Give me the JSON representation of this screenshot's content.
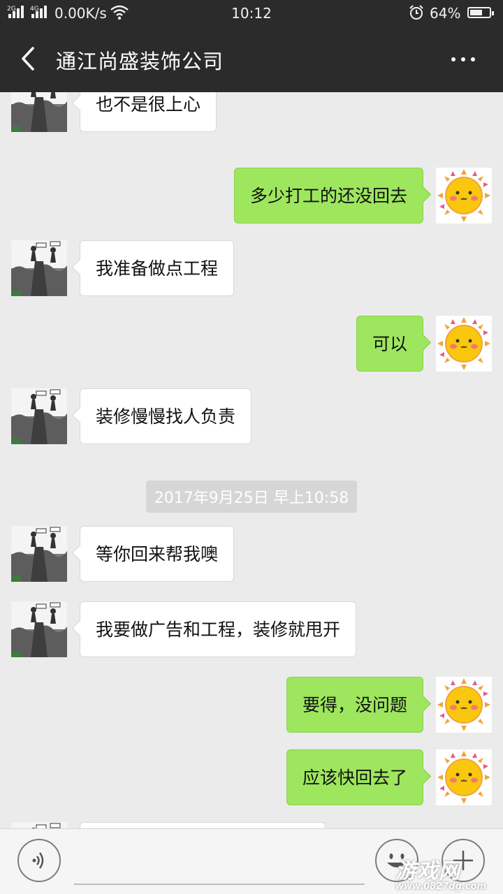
{
  "status_bar": {
    "signal_1": "2G",
    "signal_2": "4G",
    "speed": "0.00K/s",
    "time": "10:12",
    "battery_percent": "64%",
    "battery_level": 0.64
  },
  "header": {
    "title": "通江尚盛装饰公司"
  },
  "messages": [
    {
      "side": "left",
      "text": "也不是很上心"
    },
    {
      "side": "right",
      "text": "多少打工的还没回去"
    },
    {
      "side": "left",
      "text": "我准备做点工程"
    },
    {
      "side": "right",
      "text": "可以"
    },
    {
      "side": "left",
      "text": "装修慢慢找人负责"
    },
    {
      "type": "timestamp",
      "text": "2017年9月25日 早上10:58"
    },
    {
      "side": "left",
      "text": "等你回来帮我噢"
    },
    {
      "side": "left",
      "text": "我要做广告和工程，装修就甩开"
    },
    {
      "side": "right",
      "text": "要得，没问题"
    },
    {
      "side": "right",
      "text": "应该快回去了"
    }
  ],
  "input_bar": {
    "placeholder": ""
  },
  "watermark": {
    "title": "游戏网",
    "url": "www.0827dg.com"
  },
  "colors": {
    "header_bg": "#2b2b2b",
    "chat_bg": "#ebebeb",
    "sent_bubble": "#9ee65e",
    "received_bubble": "#ffffff"
  }
}
